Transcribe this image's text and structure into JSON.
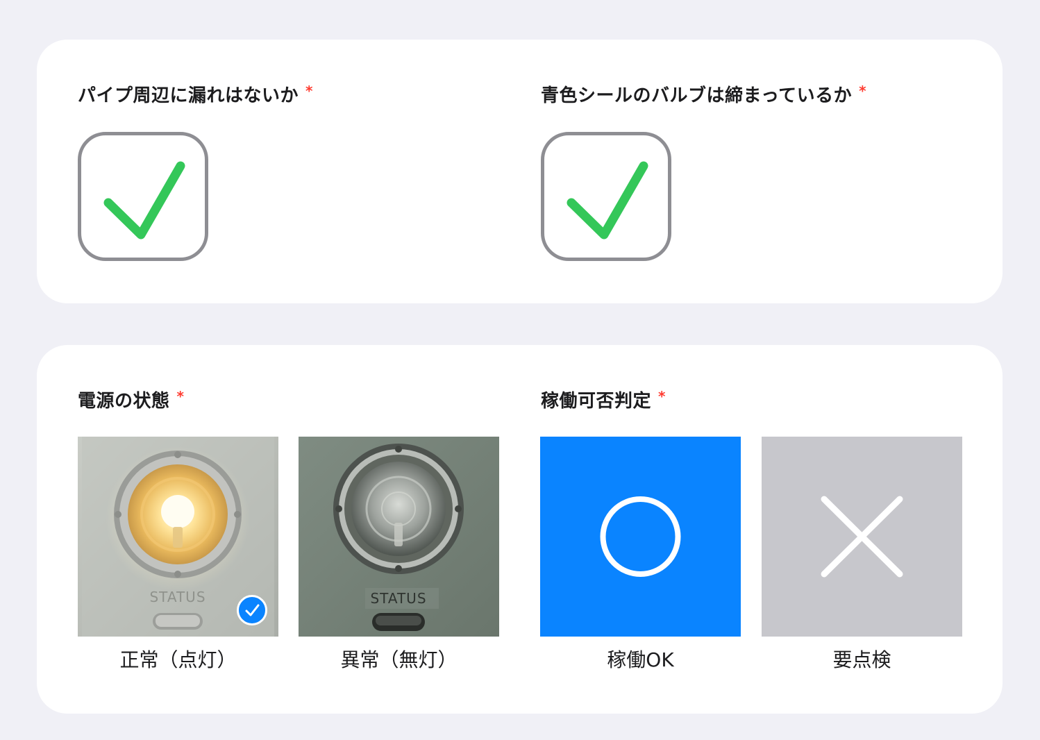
{
  "questions": [
    {
      "label": "パイプ周辺に漏れはないか",
      "required_mark": "*",
      "checked": true
    },
    {
      "label": "青色シールのバルブは締まっているか",
      "required_mark": "*",
      "checked": true
    }
  ],
  "power_status": {
    "label": "電源の状態",
    "required_mark": "*",
    "options": [
      {
        "caption": "正常（点灯）",
        "selected": true,
        "image_text": "STATUS"
      },
      {
        "caption": "異常（無灯）",
        "selected": false,
        "image_text": "STATUS"
      }
    ]
  },
  "operation_judgement": {
    "label": "稼働可否判定",
    "required_mark": "*",
    "options": [
      {
        "caption": "稼働OK",
        "icon": "circle-icon",
        "color": "#0a84ff",
        "selected": true
      },
      {
        "caption": "要点検",
        "icon": "cross-icon",
        "color": "#c7c7cc",
        "selected": false
      }
    ]
  },
  "colors": {
    "accent": "#0a84ff",
    "check_green": "#34c759",
    "required_red": "#ff3b30",
    "checkbox_border": "#8e8e93"
  }
}
